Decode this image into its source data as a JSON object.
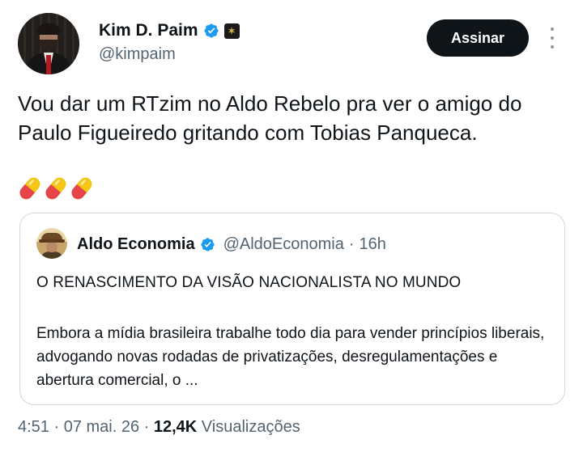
{
  "author": {
    "name": "Kim D. Paim",
    "handle": "@kimpaim",
    "verified_color": "#1d9bf0",
    "affiliate_badge_icon": "affiliate-badge-icon"
  },
  "actions": {
    "subscribe_label": "Assinar",
    "more_icon": "more-vertical-icon"
  },
  "tweet": {
    "text": "Vou dar um RTzim no Aldo Rebelo pra ver o amigo do Paulo Figueiredo gritando com Tobias Panqueca.",
    "emojis": [
      "pill-icon",
      "pill-icon",
      "pill-icon"
    ]
  },
  "quoted": {
    "name": "Aldo Economia",
    "handle": "@AldoEconomia",
    "separator": "·",
    "time": "16h",
    "title": "O RENASCIMENTO DA VISÃO NACIONALISTA NO MUNDO",
    "body": "Embora a mídia brasileira trabalhe todo dia para vender princípios liberais, advogando novas rodadas de privatizações, desregulamentações e abertura comercial, o ..."
  },
  "meta": {
    "time_date": "4:51 · 07 mai. 26 · ",
    "views_count": "12,4K",
    "views_label": " Visualizações"
  },
  "colors": {
    "text": "#0f1419",
    "secondary": "#536471",
    "border": "#cfd9de",
    "button": "#0f1419"
  }
}
